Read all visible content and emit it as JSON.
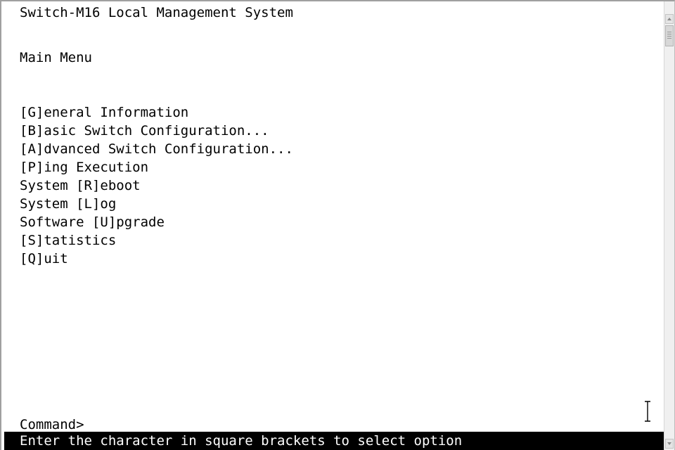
{
  "terminal": {
    "title": "Switch-M16 Local Management System",
    "menu_heading": "Main Menu",
    "menu_items": [
      {
        "label": "[G]eneral Information"
      },
      {
        "label": "[B]asic Switch Configuration..."
      },
      {
        "label": "[A]dvanced Switch Configuration..."
      },
      {
        "label": "[P]ing Execution"
      },
      {
        "label": "System [R]eboot"
      },
      {
        "label": "System [L]og"
      },
      {
        "label": "Software [U]pgrade"
      },
      {
        "label": "[S]tatistics"
      },
      {
        "label": "[Q]uit"
      }
    ],
    "command_prompt": "Command>",
    "status_message": "Enter the character in square brackets to select option"
  },
  "icons": {
    "mouse_cursor": "text-cursor-icon",
    "scroll_up": "arrow-up-icon",
    "scroll_down": "arrow-down-icon"
  },
  "colors": {
    "background": "#ffffff",
    "text": "#000000",
    "status_bar_bg": "#000000",
    "status_bar_text": "#ffffff"
  }
}
